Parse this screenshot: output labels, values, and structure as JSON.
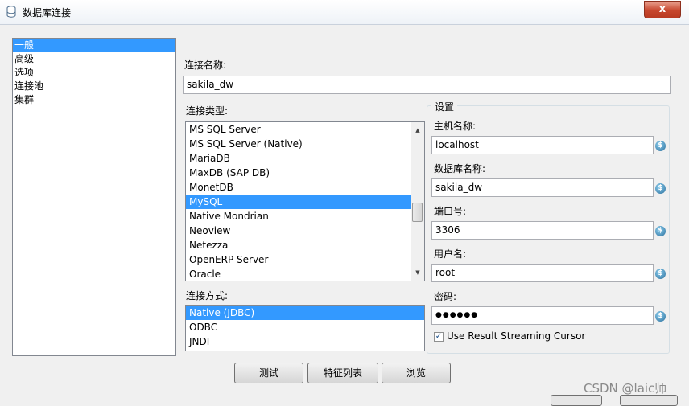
{
  "window": {
    "title": "数据库连接",
    "close_label": "x"
  },
  "nav": {
    "items": [
      "一般",
      "高级",
      "选项",
      "连接池",
      "集群"
    ],
    "selected_index": 0
  },
  "connection_name": {
    "label": "连接名称:",
    "value": "sakila_dw"
  },
  "connection_type": {
    "label": "连接类型:",
    "items": [
      "MS SQL Server",
      "MS SQL Server (Native)",
      "MariaDB",
      "MaxDB (SAP DB)",
      "MonetDB",
      "MySQL",
      "Native Mondrian",
      "Neoview",
      "Netezza",
      "OpenERP Server",
      "Oracle"
    ],
    "selected": "MySQL"
  },
  "access": {
    "label": "连接方式:",
    "items": [
      "Native (JDBC)",
      "ODBC",
      "JNDI"
    ],
    "selected": "Native (JDBC)"
  },
  "settings": {
    "title": "设置",
    "host_label": "主机名称:",
    "host_value": "localhost",
    "db_label": "数据库名称:",
    "db_value": "sakila_dw",
    "port_label": "端口号:",
    "port_value": "3306",
    "user_label": "用户名:",
    "user_value": "root",
    "password_label": "密码:",
    "password_value": "●●●●●●",
    "streaming_label": "Use Result Streaming Cursor",
    "streaming_checked": true
  },
  "buttons": {
    "test": "测试",
    "features": "特征列表",
    "browse": "浏览"
  },
  "watermark": "CSDN @laic师"
}
